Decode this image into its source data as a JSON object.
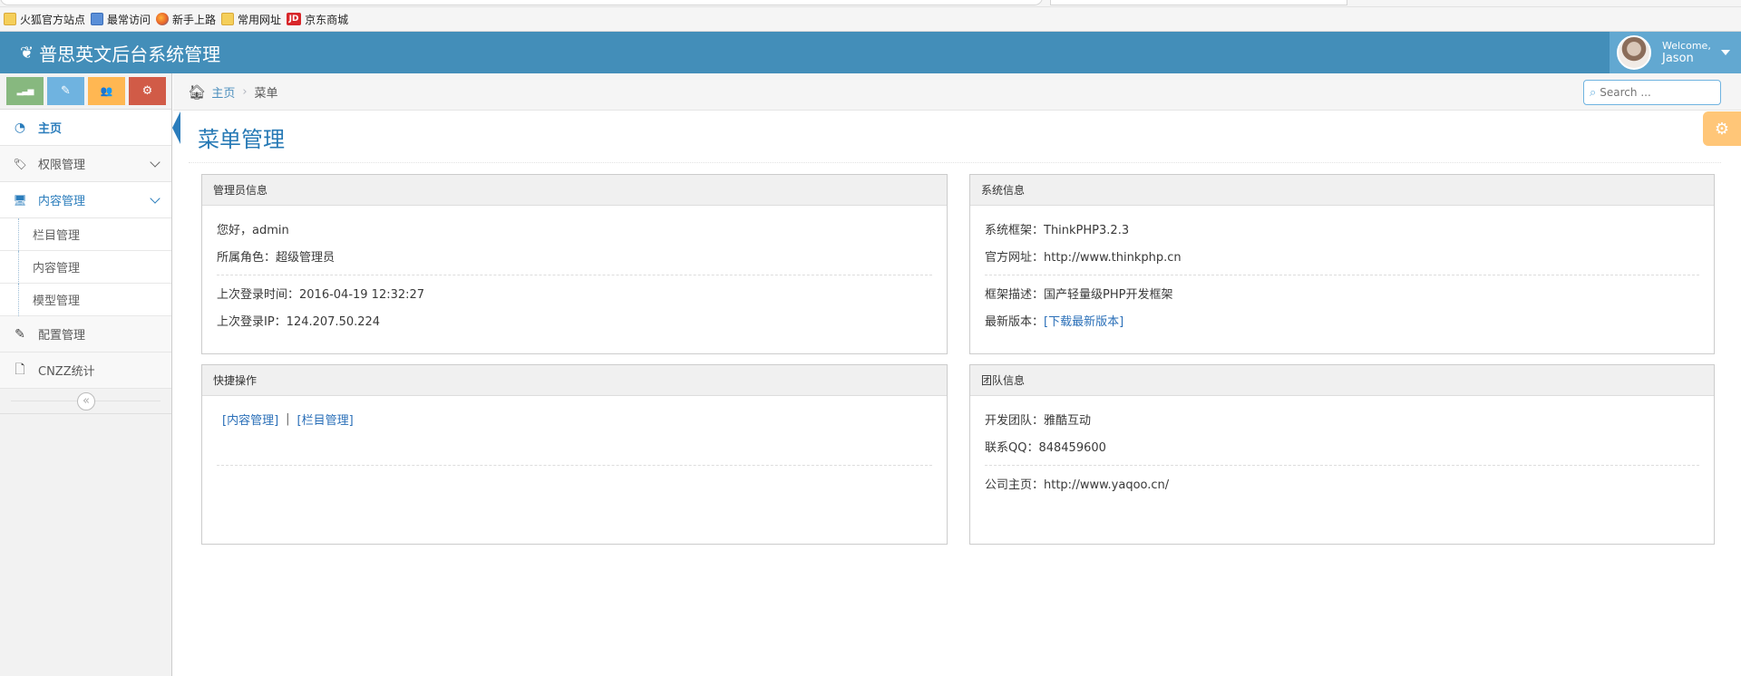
{
  "bookmarks": [
    {
      "label": "火狐官方站点",
      "icon": "folder-icon"
    },
    {
      "label": "最常访问",
      "icon": "page-icon"
    },
    {
      "label": "新手上路",
      "icon": "firefox-icon"
    },
    {
      "label": "常用网址",
      "icon": "folder-icon"
    },
    {
      "label": "京东商城",
      "icon": "jd-icon",
      "badge": "JD"
    }
  ],
  "header": {
    "brand": "普思英文后台系统管理",
    "welcome": "Welcome,",
    "username": "Jason",
    "bg_color": "#438eb9"
  },
  "shortcuts": [
    {
      "name": "chart-icon",
      "glyph": "▂▃▅"
    },
    {
      "name": "pencil-icon",
      "glyph": "✎"
    },
    {
      "name": "users-icon",
      "glyph": "👥"
    },
    {
      "name": "cogs-icon",
      "glyph": "⚙"
    }
  ],
  "sidebar": {
    "items": [
      {
        "label": "主页",
        "icon": "dashboard-icon",
        "glyph": "◔"
      },
      {
        "label": "权限管理",
        "icon": "tag-icon",
        "glyph": "🏷"
      },
      {
        "label": "内容管理",
        "icon": "desktop-icon",
        "glyph": "🖥"
      },
      {
        "label": "配置管理",
        "icon": "edit-icon",
        "glyph": "✎"
      },
      {
        "label": "CNZZ统计",
        "icon": "file-icon",
        "glyph": "🗋"
      }
    ],
    "sub_items": [
      "栏目管理",
      "内容管理",
      "模型管理"
    ],
    "collapse_glyph": "«"
  },
  "breadcrumb": {
    "home": "主页",
    "current": "菜单"
  },
  "search": {
    "placeholder": "Search ..."
  },
  "page": {
    "title": "菜单管理"
  },
  "panels": {
    "admin": {
      "title": "管理员信息",
      "greeting": "您好，admin",
      "role": "所属角色：超级管理员",
      "last_login_time": "上次登录时间：2016-04-19 12:32:27",
      "last_login_ip": "上次登录IP：124.207.50.224"
    },
    "system": {
      "title": "系统信息",
      "framework": "系统框架：ThinkPHP3.2.3",
      "website": "官方网址：http://www.thinkphp.cn",
      "description": "框架描述：国产轻量级PHP开发框架",
      "latest_label": "最新版本：",
      "latest_link": "[下载最新版本]"
    },
    "quick": {
      "title": "快捷操作",
      "link_content": "[内容管理]",
      "separator": "|",
      "link_column": "[栏目管理]"
    },
    "team": {
      "title": "团队信息",
      "team": "开发团队：雅酷互动",
      "qq": "联系QQ：848459600",
      "homepage": "公司主页：http://www.yaqoo.cn/"
    }
  }
}
